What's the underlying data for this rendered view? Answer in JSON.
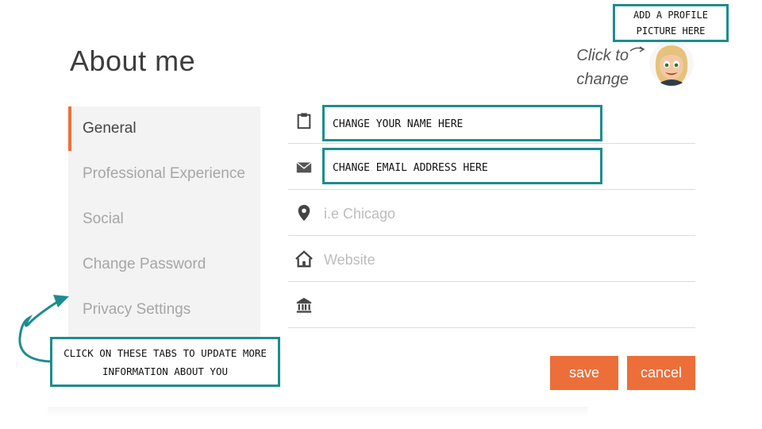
{
  "page": {
    "title": "About me"
  },
  "profile": {
    "click_to_change": "Click to change",
    "avatar_icon": "avatar-emoji-icon"
  },
  "callouts": {
    "profile_picture": "ADD A PROFILE PICTURE HERE",
    "name": "CHANGE YOUR NAME HERE",
    "email": "CHANGE EMAIL ADDRESS HERE",
    "tabs": "CLICK ON THESE TABS TO UPDATE MORE INFORMATION ABOUT YOU"
  },
  "sidebar": {
    "items": [
      {
        "label": "General",
        "active": true
      },
      {
        "label": "Professional Experience",
        "active": false
      },
      {
        "label": "Social",
        "active": false
      },
      {
        "label": "Change Password",
        "active": false
      },
      {
        "label": "Privacy Settings",
        "active": false
      }
    ]
  },
  "form": {
    "fields": [
      {
        "icon": "clipboard-icon",
        "value": "",
        "placeholder": ""
      },
      {
        "icon": "envelope-icon",
        "value": "",
        "placeholder": ""
      },
      {
        "icon": "location-pin-icon",
        "value": "",
        "placeholder": "i.e Chicago"
      },
      {
        "icon": "home-icon",
        "value": "",
        "placeholder": "Website"
      },
      {
        "icon": "bank-icon",
        "value": "",
        "placeholder": ""
      }
    ]
  },
  "actions": {
    "save_label": "save",
    "cancel_label": "cancel"
  },
  "colors": {
    "accent": "#ec6f3a",
    "callout_border": "#1e8c8f",
    "sidebar_bg": "#f3f3f3"
  }
}
